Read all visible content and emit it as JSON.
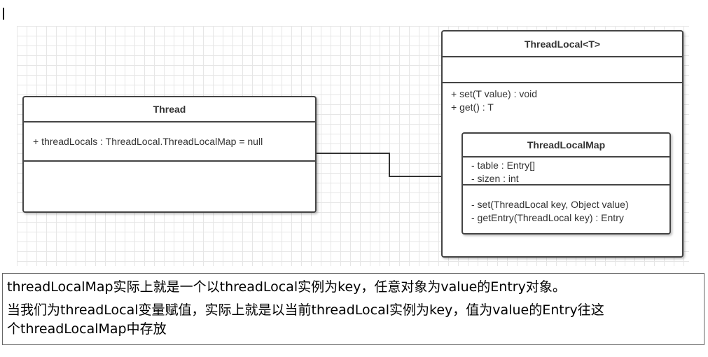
{
  "diagram": {
    "thread_class": {
      "name": "Thread",
      "attributes": [
        "+ threadLocals : ThreadLocal.ThreadLocalMap = null"
      ],
      "operations": []
    },
    "threadlocal_class": {
      "name": "ThreadLocal<T>",
      "attributes": [],
      "operations": [
        "+ set(T value) : void",
        "+ get() : T"
      ]
    },
    "threadlocalmap_class": {
      "name": "ThreadLocalMap",
      "attributes": [
        "- table : Entry[]",
        "- sizen : int"
      ],
      "operations": [
        "- set(ThreadLocal key, Object value)",
        "- getEntry(ThreadLocal key) :  Entry"
      ]
    },
    "connector": {
      "from": "Thread.threadLocals",
      "to": "ThreadLocalMap",
      "style": "arrow"
    }
  },
  "note": {
    "line1": "threadLocalMap实际上就是一个以threadLocal实例为key，任意对象为value的Entry对象。",
    "line2": "当我们为threadLocal变量赋值，实际上就是以当前threadLocal实例为key，值为value的Entry往这",
    "line3": "个threadLocalMap中存放"
  },
  "colors": {
    "border": "#444444",
    "grid": "#e6e6e6",
    "text": "#333333"
  }
}
